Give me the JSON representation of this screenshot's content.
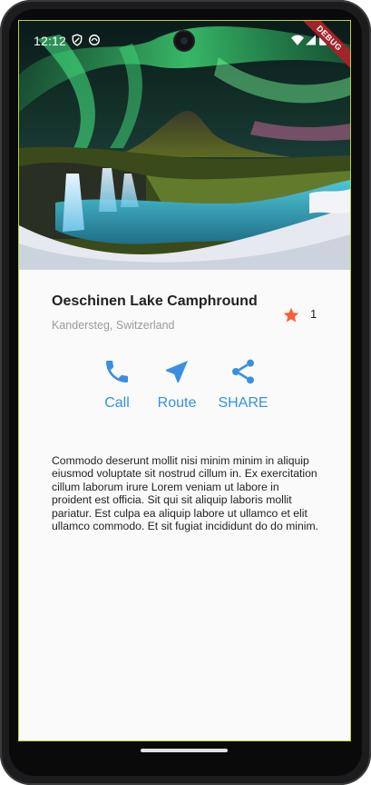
{
  "status_bar": {
    "time": "12:12",
    "debug_banner": "DEBUG",
    "left_icons": [
      "shield-icon",
      "app-status-icon"
    ],
    "right_icons": [
      "wifi-icon",
      "signal-icon",
      "battery-icon"
    ]
  },
  "hero": {
    "image_subject": "aurora-mountain-waterfall"
  },
  "place": {
    "title": "Oeschinen Lake Camphround",
    "location": "Kandersteg, Switzerland",
    "rating_count": "1",
    "star_icon": "star-icon"
  },
  "actions": [
    {
      "label": "Call",
      "icon": "phone-icon"
    },
    {
      "label": "Route",
      "icon": "navigation-icon"
    },
    {
      "label": "SHARE",
      "icon": "share-icon"
    }
  ],
  "description": "Commodo deserunt mollit nisi minim minim in aliquip eiusmod voluptate sit nostrud cillum in. Ex exercitation cillum laborum irure Lorem veniam ut labore in proident est officia. Sit qui sit aliquip laboris mollit pariatur. Est culpa ea aliquip labore ut ullamco et elit ullamco commodo. Et sit fugiat incididunt do do minim.",
  "colors": {
    "accent": "#3a8fe0",
    "star": "#f4623a",
    "title": "#222222",
    "subtitle": "#9a9a9a",
    "debug": "#a3232a"
  }
}
